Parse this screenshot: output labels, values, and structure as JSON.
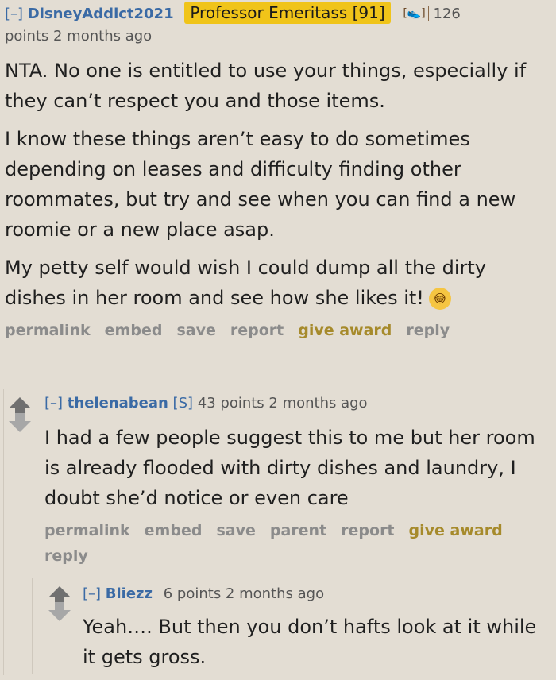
{
  "comment1": {
    "toggle": "[–]",
    "author": "DisneyAddict2021",
    "flair": "Professor Emeritass [91]",
    "gild_icon": "shoe-icon",
    "points": "126",
    "points_text": "points 2 months ago",
    "paragraphs": [
      "NTA. No one is entitled to use your things, especially if they can’t respect you and those items.",
      "I know these things aren’t easy to do sometimes depending on leases and difficulty finding other roommates, but try and see when you can find a new roomie or a new place asap.",
      "My petty self would wish I could dump all the dirty dishes in her room and see how she likes it!"
    ],
    "emoji": "😂",
    "actions": {
      "permalink": "permalink",
      "embed": "embed",
      "save": "save",
      "report": "report",
      "give_award": "give award",
      "reply": "reply"
    }
  },
  "comment2": {
    "toggle": "[–]",
    "author": "thelenabean",
    "op_tag": "[S]",
    "meta": "43 points 2 months ago",
    "text": "I had a few people suggest this to me but her room is already flooded with dirty dishes and laundry, I doubt she’d notice or even care",
    "actions": {
      "permalink": "permalink",
      "embed": "embed",
      "save": "save",
      "parent": "parent",
      "report": "report",
      "give_award": "give award",
      "reply": "reply"
    }
  },
  "comment3": {
    "toggle": "[–]",
    "author": "Bliezz",
    "meta": "6 points 2 months ago",
    "text": "Yeah…. But then you don’t hafts look at it while it gets gross."
  }
}
